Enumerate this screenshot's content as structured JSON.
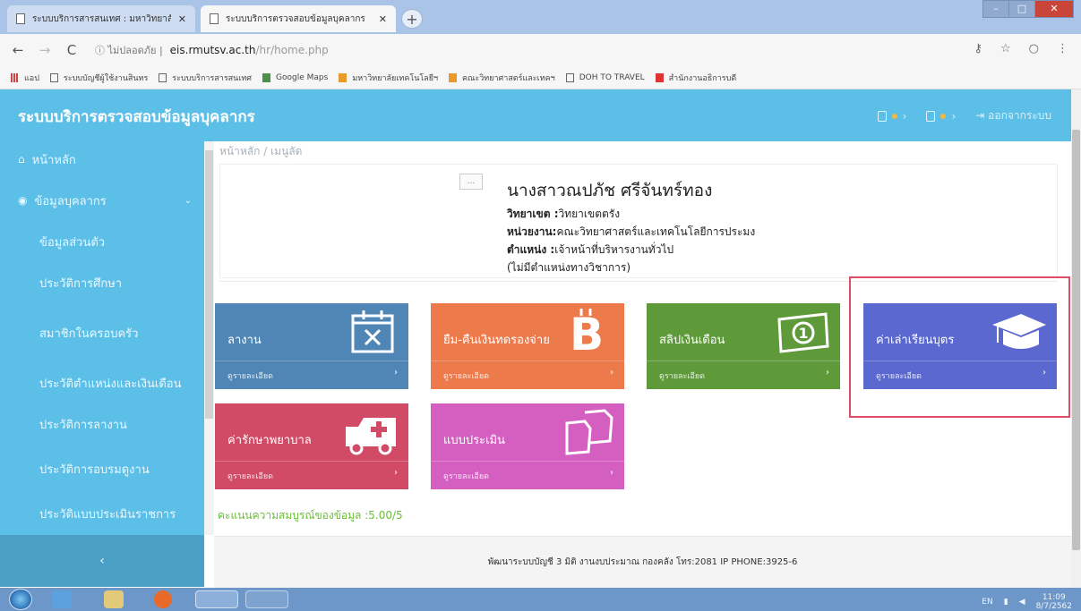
{
  "browser": {
    "tabs": [
      {
        "title": "ระบบบริการสารสนเทศ : มหาวิทยาลัย",
        "active": false
      },
      {
        "title": "ระบบบริการตรวจสอบข้อมูลบุคลากร",
        "active": true
      }
    ],
    "address": {
      "secure_label": "ไม่ปลอดภัย",
      "host": "eis.rmutsv.ac.th",
      "path": "/hr/home.php"
    },
    "bookmarks": [
      {
        "label": "แอป",
        "icon": "apps-icon"
      },
      {
        "label": "ระบบบัญชีผู้ใช้งานสินทร",
        "icon": "page-icon"
      },
      {
        "label": "ระบบบริการสารสนเทศ",
        "icon": "page-icon"
      },
      {
        "label": "Google Maps",
        "icon": "maps-icon"
      },
      {
        "label": "มหาวิทยาลัยเทคโนโลยีฯ",
        "icon": "flag-icon"
      },
      {
        "label": "คณะวิทยาศาสตร์และเทคฯ",
        "icon": "torch-icon"
      },
      {
        "label": "DOH TO TRAVEL",
        "icon": "page-icon"
      },
      {
        "label": "สำนักงานอธิการบดี",
        "icon": "red-logo-icon"
      }
    ]
  },
  "app": {
    "title": "ระบบบริการตรวจสอบข้อมูลบุคลากร",
    "logout_label": "ออกจากระบบ",
    "header_icons": [
      "bell-icon",
      "calendar-icon"
    ]
  },
  "sidebar": {
    "home": "หน้าหลัก",
    "group": "ข้อมูลบุคลากร",
    "items": [
      "ข้อมูลส่วนตัว",
      "ประวัติการศึกษา",
      "สมาชิกในครอบครัว",
      "ประวัติตำแหน่งและเงินเดือน",
      "ประวัติการลางาน",
      "ประวัติการอบรมดูงาน",
      "ประวัติแบบประเมินราชการ"
    ],
    "collapse_icon": "‹"
  },
  "content": {
    "breadcrumb": "หน้าหลัก / เมนูลัด",
    "photo_alt": "...",
    "profile": {
      "name": "นางสาวณปภัช ศรีจันทร์ทอง",
      "campus_label": "วิทยาเขต :",
      "campus": "วิทยาเขตตรัง",
      "unit_label": "หน่วยงาน:",
      "unit": "คณะวิทยาศาสตร์และเทคโนโลยีการประมง",
      "position_label": "ตำแหน่ง :",
      "position": "เจ้าหน้าที่บริหารงานทั่วไป",
      "academic": "(ไม่มีตำแหน่งทางวิชาการ)"
    },
    "tiles": [
      {
        "label": "ลางาน",
        "more": "ดูรายละเอียด",
        "color": "#4f86b5",
        "icon": "calendar-x-icon"
      },
      {
        "label": "ยืม-คืนเงินทดรองจ่าย",
        "more": "ดูรายละเอียด",
        "color": "#ec7a4b",
        "icon": "bitcoin-icon"
      },
      {
        "label": "สลิปเงินเดือน",
        "more": "ดูรายละเอียด",
        "color": "#5e9a3a",
        "icon": "banknote-icon"
      },
      {
        "label": "ค่าเล่าเรียนบุตร",
        "more": "ดูรายละเอียด",
        "color": "#5a68cf",
        "icon": "graduation-cap-icon"
      },
      {
        "label": "ค่ารักษาพยาบาล",
        "more": "ดูรายละเอียด",
        "color": "#d14a66",
        "icon": "ambulance-icon"
      },
      {
        "label": "แบบประเมิน",
        "more": "ดูรายละเอียด",
        "color": "#d45fc1",
        "icon": "documents-icon"
      }
    ],
    "score": "คะแนนความสมบูรณ์ของข้อมูล :5.00/5",
    "footer": "พัฒนาระบบบัญชี 3 มิติ งานงบประมาณ กองคลัง โทร:2081 IP PHONE:3925-6"
  },
  "taskbar": {
    "lang": "EN",
    "time": "11:09",
    "date": "8/7/2562"
  }
}
